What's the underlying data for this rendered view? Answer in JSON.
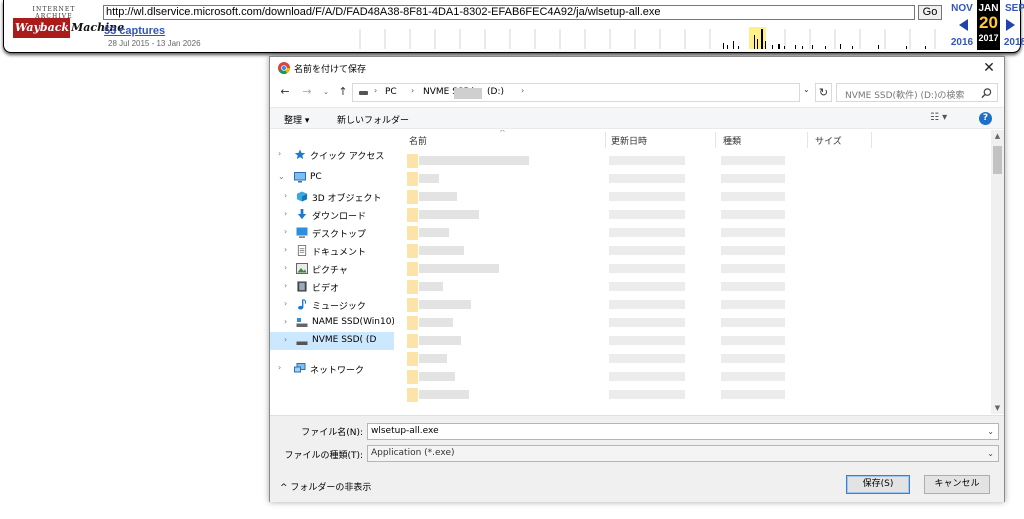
{
  "wayback": {
    "logo_top": "INTERNET ARCHIVE",
    "logo_way": "Wayback",
    "logo_machine": "Machine",
    "url": "http://wl.dlservice.microsoft.com/download/F/A/D/FAD48A38-8F81-4DA1-8302-EFAB6FEC4A92/ja/wlsetup-all.exe",
    "go_label": "Go",
    "captures": "53 captures",
    "date_range": "28 Jul 2015 - 13 Jan 2026",
    "prev_month": "NOV",
    "prev_year": "2016",
    "current_month": "JAN",
    "current_day": "20",
    "current_year": "2017",
    "next_month": "SEP",
    "next_year": "2018"
  },
  "dialog": {
    "title": "名前を付けて保存",
    "close": "✕",
    "address": {
      "crumb_pc": "PC",
      "crumb_drive": "NVME SSD(",
      "crumb_drive_b": "(D:)",
      "search_placeholder": "NVME SSD(軟件) (D:)の検索"
    },
    "toolbar": {
      "organize": "整理 ▾",
      "new_folder": "新しいフォルダー",
      "view": "☷ ▾",
      "help": "?"
    },
    "nav": [
      {
        "label": "クイック アクセス",
        "chev": "›",
        "icon": "star"
      },
      {
        "label": "PC",
        "chev": "⌄",
        "icon": "pc"
      },
      {
        "label": "3D オブジェクト",
        "chev": "›",
        "icon": "cube"
      },
      {
        "label": "ダウンロード",
        "chev": "›",
        "icon": "download"
      },
      {
        "label": "デスクトップ",
        "chev": "›",
        "icon": "desktop"
      },
      {
        "label": "ドキュメント",
        "chev": "›",
        "icon": "document"
      },
      {
        "label": "ピクチャ",
        "chev": "›",
        "icon": "pictures"
      },
      {
        "label": "ビデオ",
        "chev": "›",
        "icon": "video"
      },
      {
        "label": "ミュージック",
        "chev": "›",
        "icon": "music"
      },
      {
        "label": "NAME SSD(Win10) (",
        "chev": "›",
        "icon": "drive"
      },
      {
        "label": "NVME SSD(       (D",
        "chev": "›",
        "icon": "drive"
      },
      {
        "label": "ネットワーク",
        "chev": "›",
        "icon": "network"
      }
    ],
    "columns": {
      "name": "名前",
      "modified": "更新日時",
      "type": "種類",
      "size": "サイズ"
    },
    "fields": {
      "filename_label": "ファイル名(N):",
      "filename_value": "wlsetup-all.exe",
      "filetype_label": "ファイルの種類(T):",
      "filetype_value": "Application (*.exe)"
    },
    "hide_folders": "フォルダーの非表示",
    "save": "保存(S)",
    "cancel": "キャンセル"
  }
}
